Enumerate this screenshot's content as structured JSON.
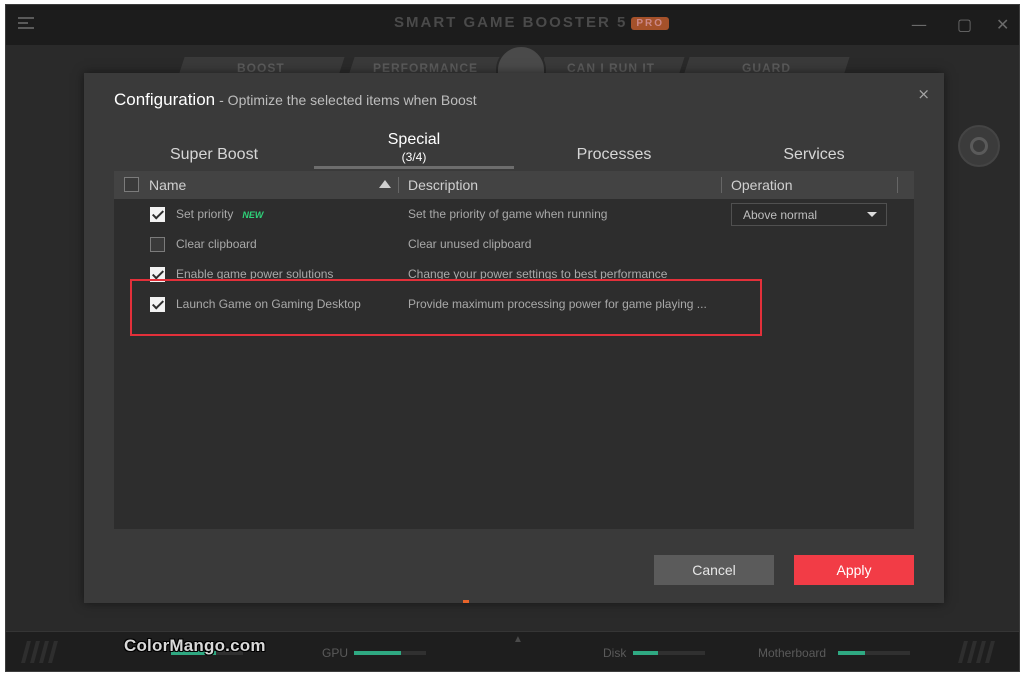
{
  "app": {
    "title": "SMART GAME BOOSTER 5",
    "badge": "PRO",
    "tabs": [
      "BOOST",
      "PERFORMANCE",
      "CAN I RUN IT",
      "GUARD"
    ],
    "footer": {
      "gpu_label": "GPU",
      "disk_label": "Disk",
      "motherboard_label": "Motherboard",
      "cpu_level": 0.62,
      "gpu_level": 0.65,
      "disk_level": 0.35,
      "motherboard_level": 0.38
    }
  },
  "watermark": "ColorMango.com",
  "dialog": {
    "title": "Configuration",
    "subtitle": "- Optimize the selected items when Boost",
    "close_glyph": "×",
    "tabs": [
      {
        "label": "Super Boost",
        "count": ""
      },
      {
        "label": "Special",
        "count": "(3/4)"
      },
      {
        "label": "Processes",
        "count": ""
      },
      {
        "label": "Services",
        "count": ""
      }
    ],
    "active_tab": "Special",
    "table": {
      "headers": {
        "name": "Name",
        "description": "Description",
        "operation": "Operation"
      },
      "rows": [
        {
          "name": "Set priority",
          "tag": "NEW",
          "description": "Set the priority of game when running",
          "checked": true,
          "operation": "Above normal"
        },
        {
          "name": "Clear clipboard",
          "tag": "",
          "description": "Clear unused clipboard",
          "checked": false,
          "operation": ""
        },
        {
          "name": "Enable game power solutions",
          "tag": "",
          "description": "Change your power settings to best performance",
          "checked": true,
          "operation": ""
        },
        {
          "name": "Launch Game on Gaming Desktop",
          "tag": "",
          "description": "Provide maximum processing power for game playing ...",
          "checked": true,
          "operation": ""
        }
      ]
    },
    "buttons": {
      "cancel": "Cancel",
      "apply": "Apply"
    }
  },
  "colors": {
    "apply_button": "#f23c46",
    "highlight_border": "#e3303a",
    "new_tag": "#2ed47a",
    "meter": "#2fa982"
  }
}
